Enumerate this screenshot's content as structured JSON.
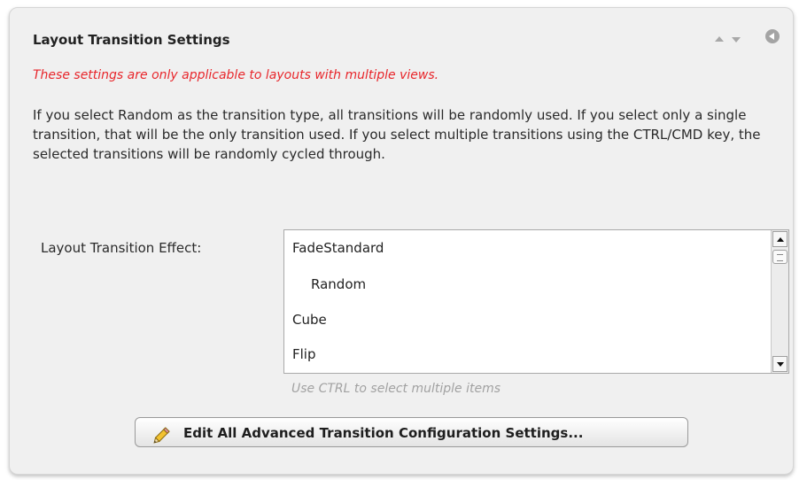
{
  "panel": {
    "title": "Layout Transition Settings",
    "warning": "These settings are only applicable to layouts with multiple views.",
    "description": "If you select Random as the transition type, all transitions will be randomly used. If you select only a single transition, that will be the only transition used.  If you select multiple transitions using the CTRL/CMD key, the selected transitions will be randomly cycled through.",
    "controls": {
      "move_up": "arrow-up-icon",
      "move_down": "arrow-down-icon",
      "collapse": "collapse-icon"
    }
  },
  "transition_field": {
    "label": "Layout Transition Effect:",
    "options": [
      {
        "label": "FadeStandard",
        "indent": false
      },
      {
        "label": "Random",
        "indent": true
      },
      {
        "label": "Cube",
        "indent": false
      },
      {
        "label": "Flip",
        "indent": false
      }
    ],
    "hint": "Use CTRL to select multiple items"
  },
  "edit_button": {
    "label": "Edit All Advanced Transition Configuration Settings...",
    "icon": "pencil-icon"
  },
  "colors": {
    "warning": "#e8262b",
    "hint": "#a2a2a2",
    "panel_bg": "#f0f0f0"
  }
}
